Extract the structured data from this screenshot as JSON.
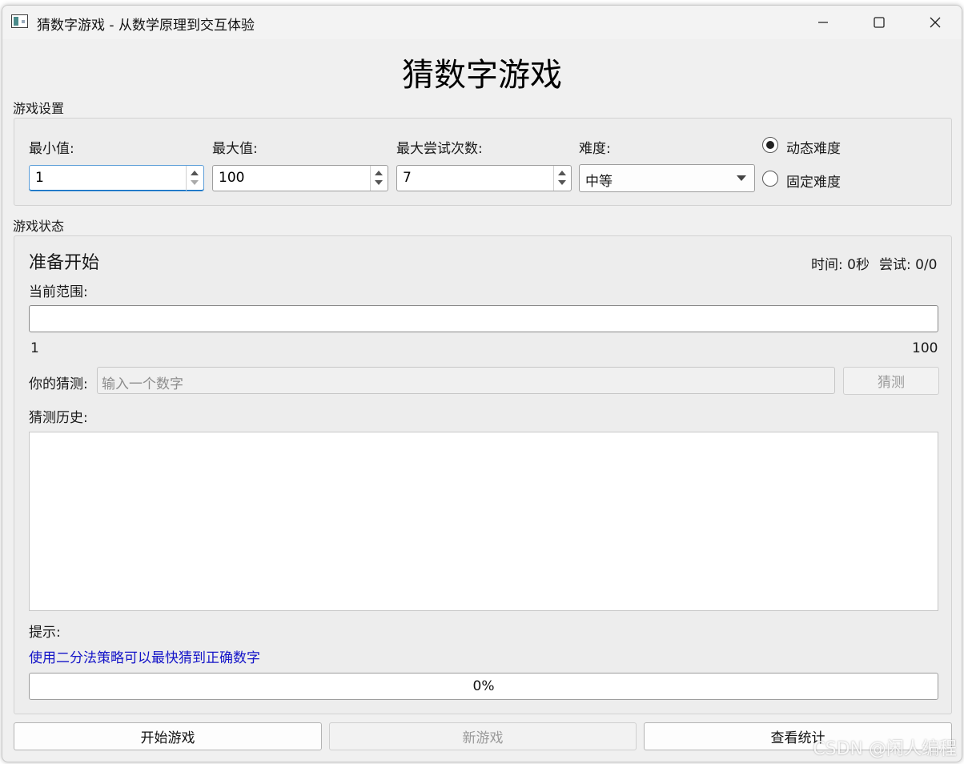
{
  "window": {
    "title": "猜数字游戏 - 从数学原理到交互体验"
  },
  "heading": "猜数字游戏",
  "settings": {
    "group_title": "游戏设置",
    "min_label": "最小值:",
    "min_value": "1",
    "max_label": "最大值:",
    "max_value": "100",
    "attempts_label": "最大尝试次数:",
    "attempts_value": "7",
    "difficulty_label": "难度:",
    "difficulty_value": "中等",
    "radio_dynamic": "动态难度",
    "radio_fixed": "固定难度",
    "selected_radio": "dynamic"
  },
  "status": {
    "group_title": "游戏状态",
    "state_text": "准备开始",
    "time_text": "时间: 0秒",
    "attempts_text": "尝试: 0/0",
    "range_label": "当前范围:",
    "range_min": "1",
    "range_max": "100",
    "guess_label": "你的猜测:",
    "guess_placeholder": "输入一个数字",
    "guess_button": "猜测",
    "history_label": "猜测历史:",
    "hint_label": "提示:",
    "hint_text": "使用二分法策略可以最快猜到正确数字",
    "progress_text": "0%",
    "progress_value": 0
  },
  "buttons": {
    "start": "开始游戏",
    "new": "新游戏",
    "stats": "查看统计"
  },
  "watermark": "CSDN @闲人编程",
  "colors": {
    "hint": "#1414c8",
    "focus_border": "#5d9ed8"
  }
}
